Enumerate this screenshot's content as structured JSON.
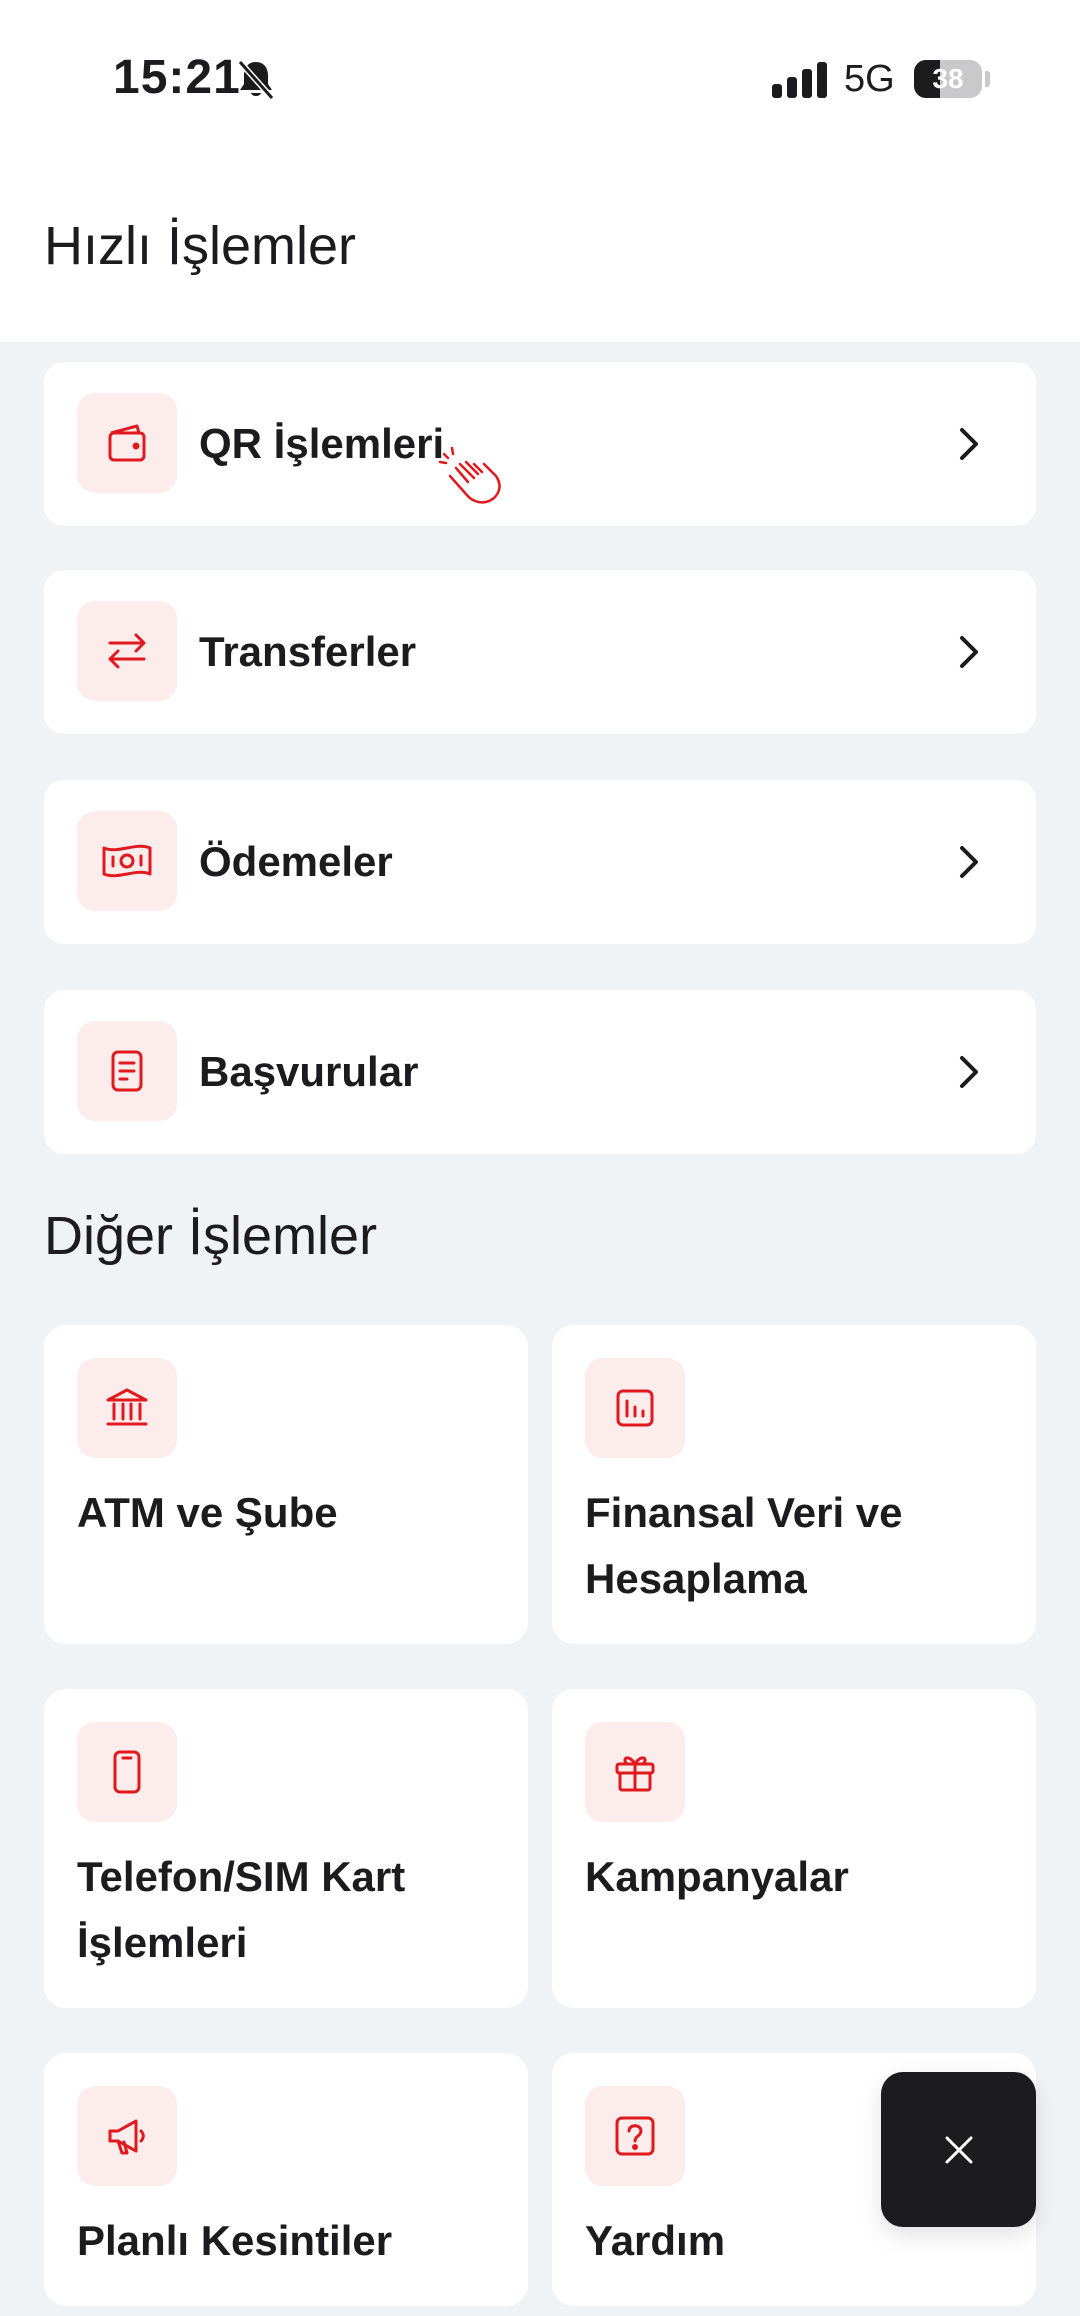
{
  "status_bar": {
    "time": "15:21",
    "network": "5G",
    "battery": "38"
  },
  "header": {
    "title": "Hızlı İşlemler"
  },
  "quick_actions": [
    {
      "label": "QR İşlemleri",
      "icon": "wallet-icon"
    },
    {
      "label": "Transferler",
      "icon": "transfer-arrows-icon"
    },
    {
      "label": "Ödemeler",
      "icon": "banknote-icon"
    },
    {
      "label": "Başvurular",
      "icon": "document-icon"
    }
  ],
  "other_section": {
    "title": "Diğer İşlemler",
    "items": [
      {
        "label": "ATM ve Şube",
        "icon": "bank-icon"
      },
      {
        "label": "Finansal Veri ve Hesaplama",
        "icon": "chart-icon"
      },
      {
        "label": "Telefon/SIM Kart İşlemleri",
        "icon": "phone-icon"
      },
      {
        "label": "Kampanyalar",
        "icon": "gift-icon"
      },
      {
        "label": "Planlı Kesintiler",
        "icon": "megaphone-icon"
      },
      {
        "label": "Yardım",
        "icon": "help-icon"
      }
    ]
  },
  "colors": {
    "accent": "#E0191E",
    "icon_bg": "#FDECEC",
    "page_bg": "#F0F3F6",
    "text": "#1C1C1E"
  }
}
